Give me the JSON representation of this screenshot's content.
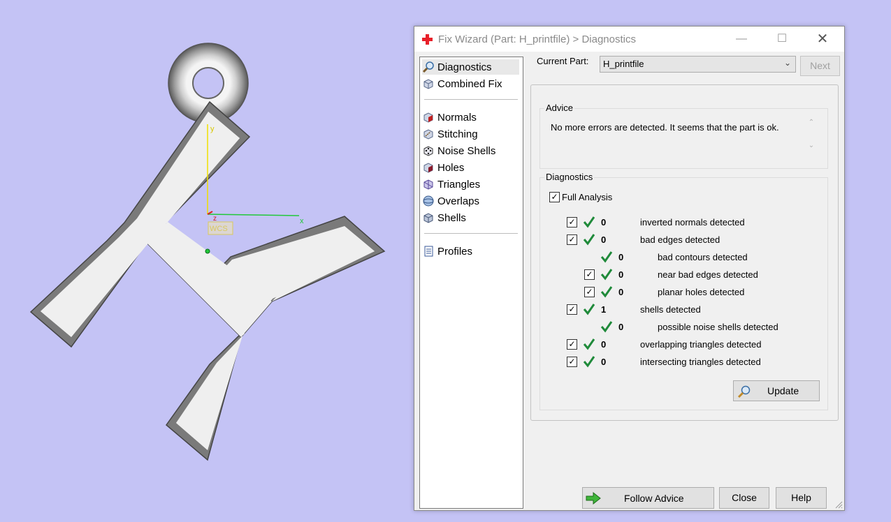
{
  "window": {
    "title": "Fix Wizard (Part: H_printfile) > Diagnostics",
    "minimize_glyph": "—",
    "maximize_glyph": "☐",
    "close_glyph": "✕"
  },
  "viewport": {
    "axis_y_label": "y",
    "axis_x_label": "x",
    "axis_z_label": "z",
    "wcs_label": "WCS"
  },
  "sidebar": {
    "items": [
      {
        "label": "Diagnostics",
        "icon": "magnifier-icon",
        "selected": true
      },
      {
        "label": "Combined Fix",
        "icon": "cube-icon"
      },
      {
        "label": "Normals",
        "icon": "cube-red-face-icon"
      },
      {
        "label": "Stitching",
        "icon": "stitch-cube-icon"
      },
      {
        "label": "Noise Shells",
        "icon": "dice-icon"
      },
      {
        "label": "Holes",
        "icon": "cube-hole-icon"
      },
      {
        "label": "Triangles",
        "icon": "triangle-cube-icon"
      },
      {
        "label": "Overlaps",
        "icon": "overlap-sphere-icon"
      },
      {
        "label": "Shells",
        "icon": "shell-cube-icon"
      },
      {
        "label": "Profiles",
        "icon": "document-icon"
      }
    ]
  },
  "current_part": {
    "label": "Current Part:",
    "value": "H_printfile",
    "next_label": "Next"
  },
  "advice": {
    "title": "Advice",
    "text": "No more errors are detected. It seems that the part is ok."
  },
  "diagnostics": {
    "title": "Diagnostics",
    "full_analysis_label": "Full Analysis",
    "full_analysis_checked": true,
    "rows": [
      {
        "checkbox": true,
        "count": "0",
        "label": "inverted normals detected",
        "indent": 0
      },
      {
        "checkbox": true,
        "count": "0",
        "label": "bad edges detected",
        "indent": 0
      },
      {
        "checkbox": false,
        "count": "0",
        "label": "bad contours detected",
        "indent": 1
      },
      {
        "checkbox": true,
        "count": "0",
        "label": "near bad edges detected",
        "indent": 1
      },
      {
        "checkbox": true,
        "count": "0",
        "label": "planar holes detected",
        "indent": 1
      },
      {
        "checkbox": true,
        "count": "1",
        "label": "shells detected",
        "indent": 0
      },
      {
        "checkbox": false,
        "count": "0",
        "label": "possible noise shells detected",
        "indent": 1
      },
      {
        "checkbox": true,
        "count": "0",
        "label": "overlapping triangles detected",
        "indent": 0
      },
      {
        "checkbox": true,
        "count": "0",
        "label": "intersecting triangles detected",
        "indent": 0
      }
    ],
    "update_label": "Update"
  },
  "footer": {
    "follow_advice_label": "Follow Advice",
    "close_label": "Close",
    "help_label": "Help"
  },
  "colors": {
    "background": "#c4c3f5",
    "check_green": "#1f8a3a",
    "axis_y": "#f0e000",
    "axis_x": "#22c83a",
    "app_icon_red": "#e8202a"
  }
}
